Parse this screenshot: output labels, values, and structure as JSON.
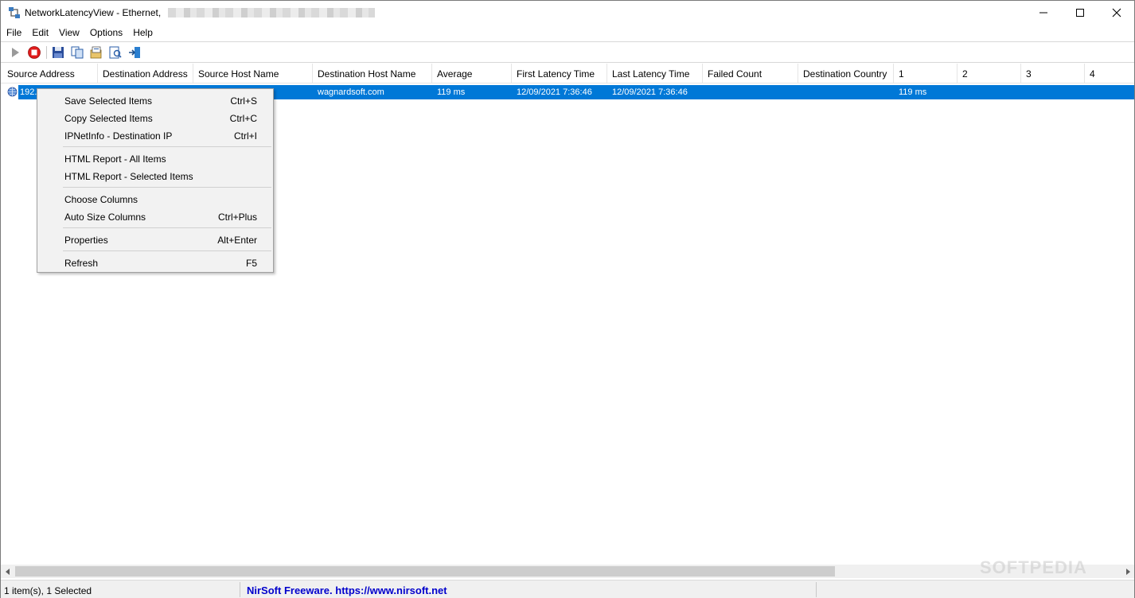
{
  "window": {
    "title": "NetworkLatencyView  -  Ethernet,",
    "minimize_icon": "minimize-icon",
    "maximize_icon": "maximize-icon",
    "close_icon": "close-icon"
  },
  "menu": [
    "File",
    "Edit",
    "View",
    "Options",
    "Help"
  ],
  "toolbar": {
    "icons": [
      "start-icon",
      "stop-icon",
      "save-icon",
      "copy-icon",
      "html-report-icon",
      "properties-icon",
      "exit-icon"
    ]
  },
  "columns": [
    "Source Address",
    "Destination Address",
    "Source Host Name",
    "Destination Host Name",
    "Average",
    "First Latency Time",
    "Last Latency Time",
    "Failed Count",
    "Destination Country",
    "1",
    "2",
    "3",
    "4"
  ],
  "rows": [
    {
      "source_address": "192.",
      "destination_host_name": "wagnardsoft.com",
      "average": "119 ms",
      "first_latency_time": "12/09/2021 7:36:46",
      "last_latency_time": "12/09/2021 7:36:46",
      "col1": "119 ms"
    }
  ],
  "context_menu": {
    "items": [
      {
        "label": "Save Selected Items",
        "shortcut": "Ctrl+S"
      },
      {
        "label": "Copy Selected Items",
        "shortcut": "Ctrl+C"
      },
      {
        "label": "IPNetInfo - Destination IP",
        "shortcut": "Ctrl+I"
      },
      {
        "label": "HTML Report - All Items",
        "shortcut": ""
      },
      {
        "label": "HTML Report - Selected Items",
        "shortcut": ""
      },
      {
        "label": "Choose Columns",
        "shortcut": ""
      },
      {
        "label": "Auto Size Columns",
        "shortcut": "Ctrl+Plus"
      },
      {
        "label": "Properties",
        "shortcut": "Alt+Enter"
      },
      {
        "label": "Refresh",
        "shortcut": "F5"
      }
    ]
  },
  "status": {
    "items": "1 item(s), 1 Selected",
    "link": "NirSoft Freeware. https://www.nirsoft.net"
  },
  "watermark": "SOFTPEDIA",
  "colors": {
    "selection": "#0078d7",
    "link": "#0000cc",
    "stop": "#e01b1b"
  }
}
